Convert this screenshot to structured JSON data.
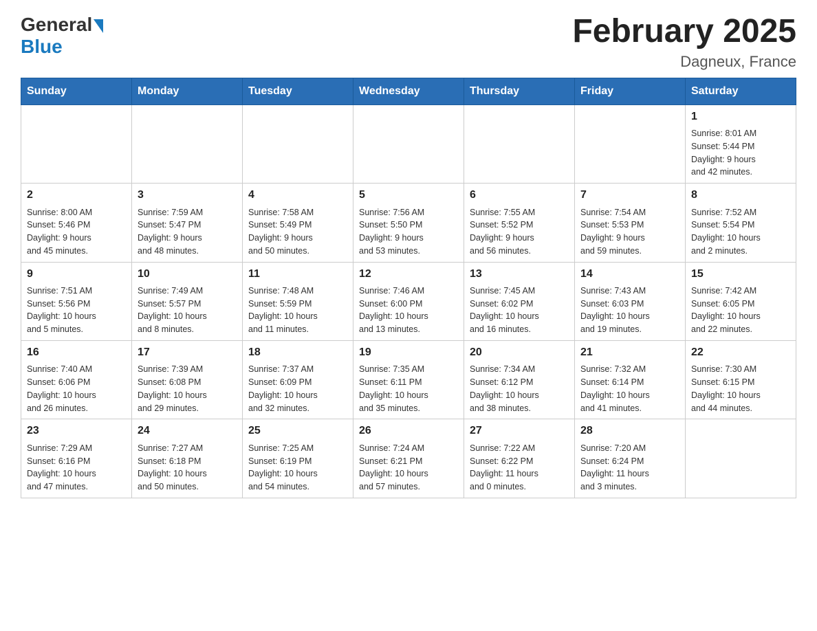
{
  "header": {
    "logo_general": "General",
    "logo_blue": "Blue",
    "title": "February 2025",
    "location": "Dagneux, France"
  },
  "days_of_week": [
    "Sunday",
    "Monday",
    "Tuesday",
    "Wednesday",
    "Thursday",
    "Friday",
    "Saturday"
  ],
  "weeks": [
    [
      {
        "day": "",
        "info": ""
      },
      {
        "day": "",
        "info": ""
      },
      {
        "day": "",
        "info": ""
      },
      {
        "day": "",
        "info": ""
      },
      {
        "day": "",
        "info": ""
      },
      {
        "day": "",
        "info": ""
      },
      {
        "day": "1",
        "info": "Sunrise: 8:01 AM\nSunset: 5:44 PM\nDaylight: 9 hours\nand 42 minutes."
      }
    ],
    [
      {
        "day": "2",
        "info": "Sunrise: 8:00 AM\nSunset: 5:46 PM\nDaylight: 9 hours\nand 45 minutes."
      },
      {
        "day": "3",
        "info": "Sunrise: 7:59 AM\nSunset: 5:47 PM\nDaylight: 9 hours\nand 48 minutes."
      },
      {
        "day": "4",
        "info": "Sunrise: 7:58 AM\nSunset: 5:49 PM\nDaylight: 9 hours\nand 50 minutes."
      },
      {
        "day": "5",
        "info": "Sunrise: 7:56 AM\nSunset: 5:50 PM\nDaylight: 9 hours\nand 53 minutes."
      },
      {
        "day": "6",
        "info": "Sunrise: 7:55 AM\nSunset: 5:52 PM\nDaylight: 9 hours\nand 56 minutes."
      },
      {
        "day": "7",
        "info": "Sunrise: 7:54 AM\nSunset: 5:53 PM\nDaylight: 9 hours\nand 59 minutes."
      },
      {
        "day": "8",
        "info": "Sunrise: 7:52 AM\nSunset: 5:54 PM\nDaylight: 10 hours\nand 2 minutes."
      }
    ],
    [
      {
        "day": "9",
        "info": "Sunrise: 7:51 AM\nSunset: 5:56 PM\nDaylight: 10 hours\nand 5 minutes."
      },
      {
        "day": "10",
        "info": "Sunrise: 7:49 AM\nSunset: 5:57 PM\nDaylight: 10 hours\nand 8 minutes."
      },
      {
        "day": "11",
        "info": "Sunrise: 7:48 AM\nSunset: 5:59 PM\nDaylight: 10 hours\nand 11 minutes."
      },
      {
        "day": "12",
        "info": "Sunrise: 7:46 AM\nSunset: 6:00 PM\nDaylight: 10 hours\nand 13 minutes."
      },
      {
        "day": "13",
        "info": "Sunrise: 7:45 AM\nSunset: 6:02 PM\nDaylight: 10 hours\nand 16 minutes."
      },
      {
        "day": "14",
        "info": "Sunrise: 7:43 AM\nSunset: 6:03 PM\nDaylight: 10 hours\nand 19 minutes."
      },
      {
        "day": "15",
        "info": "Sunrise: 7:42 AM\nSunset: 6:05 PM\nDaylight: 10 hours\nand 22 minutes."
      }
    ],
    [
      {
        "day": "16",
        "info": "Sunrise: 7:40 AM\nSunset: 6:06 PM\nDaylight: 10 hours\nand 26 minutes."
      },
      {
        "day": "17",
        "info": "Sunrise: 7:39 AM\nSunset: 6:08 PM\nDaylight: 10 hours\nand 29 minutes."
      },
      {
        "day": "18",
        "info": "Sunrise: 7:37 AM\nSunset: 6:09 PM\nDaylight: 10 hours\nand 32 minutes."
      },
      {
        "day": "19",
        "info": "Sunrise: 7:35 AM\nSunset: 6:11 PM\nDaylight: 10 hours\nand 35 minutes."
      },
      {
        "day": "20",
        "info": "Sunrise: 7:34 AM\nSunset: 6:12 PM\nDaylight: 10 hours\nand 38 minutes."
      },
      {
        "day": "21",
        "info": "Sunrise: 7:32 AM\nSunset: 6:14 PM\nDaylight: 10 hours\nand 41 minutes."
      },
      {
        "day": "22",
        "info": "Sunrise: 7:30 AM\nSunset: 6:15 PM\nDaylight: 10 hours\nand 44 minutes."
      }
    ],
    [
      {
        "day": "23",
        "info": "Sunrise: 7:29 AM\nSunset: 6:16 PM\nDaylight: 10 hours\nand 47 minutes."
      },
      {
        "day": "24",
        "info": "Sunrise: 7:27 AM\nSunset: 6:18 PM\nDaylight: 10 hours\nand 50 minutes."
      },
      {
        "day": "25",
        "info": "Sunrise: 7:25 AM\nSunset: 6:19 PM\nDaylight: 10 hours\nand 54 minutes."
      },
      {
        "day": "26",
        "info": "Sunrise: 7:24 AM\nSunset: 6:21 PM\nDaylight: 10 hours\nand 57 minutes."
      },
      {
        "day": "27",
        "info": "Sunrise: 7:22 AM\nSunset: 6:22 PM\nDaylight: 11 hours\nand 0 minutes."
      },
      {
        "day": "28",
        "info": "Sunrise: 7:20 AM\nSunset: 6:24 PM\nDaylight: 11 hours\nand 3 minutes."
      },
      {
        "day": "",
        "info": ""
      }
    ]
  ]
}
